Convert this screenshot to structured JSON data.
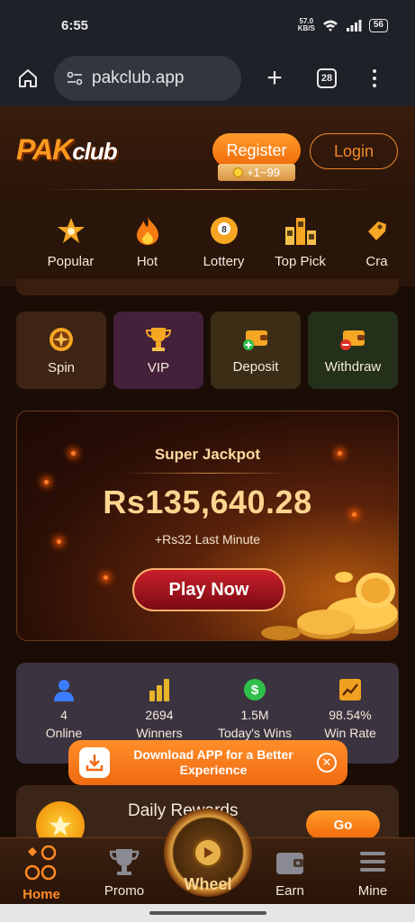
{
  "status_bar": {
    "time": "6:55",
    "net_speed_value": "57.0",
    "net_speed_unit": "KB/S",
    "battery": "56"
  },
  "browser": {
    "url": "pakclub.app",
    "tab_count": "28"
  },
  "header": {
    "logo_pak": "PAK",
    "logo_club": "club",
    "register_label": "Register",
    "bonus_text": "+1~99",
    "login_label": "Login"
  },
  "categories": [
    {
      "label": "Popular",
      "icon": "star-icon"
    },
    {
      "label": "Hot",
      "icon": "flame-icon"
    },
    {
      "label": "Lottery",
      "icon": "billiard-ball-icon"
    },
    {
      "label": "Top Pick",
      "icon": "podium-icon"
    },
    {
      "label": "Cra",
      "icon": "crash-icon"
    }
  ],
  "quick_actions": [
    {
      "label": "Spin",
      "icon": "spin-wheel-icon"
    },
    {
      "label": "VIP",
      "icon": "trophy-icon"
    },
    {
      "label": "Deposit",
      "icon": "wallet-plus-icon"
    },
    {
      "label": "Withdraw",
      "icon": "wallet-minus-icon"
    }
  ],
  "jackpot": {
    "title": "Super Jackpot",
    "amount": "Rs135,640.28",
    "subtitle": "+Rs32 Last Minute",
    "play_label": "Play Now"
  },
  "stats": [
    {
      "value": "4",
      "label": "Online",
      "icon": "user-icon",
      "color": "#3b7dff"
    },
    {
      "value": "2694",
      "label": "Winners",
      "icon": "bar-chart-icon",
      "color": "#e8b42a"
    },
    {
      "value": "1.5M",
      "label": "Today's Wins",
      "icon": "dollar-icon",
      "color": "#2fbf4a"
    },
    {
      "value": "98.54%",
      "label": "Win Rate",
      "icon": "trend-icon",
      "color": "#f0a020"
    }
  ],
  "download_banner": {
    "text_line1": "Download APP for a Better",
    "text_line2": "Experience"
  },
  "daily_rewards": {
    "title": "Daily Rewards",
    "go_label": "Go"
  },
  "bottom_nav": {
    "home": "Home",
    "promo": "Promo",
    "wheel": "Wheel",
    "earn": "Earn",
    "mine": "Mine"
  },
  "colors": {
    "accent": "#f27a14",
    "background": "#1a0d06"
  }
}
